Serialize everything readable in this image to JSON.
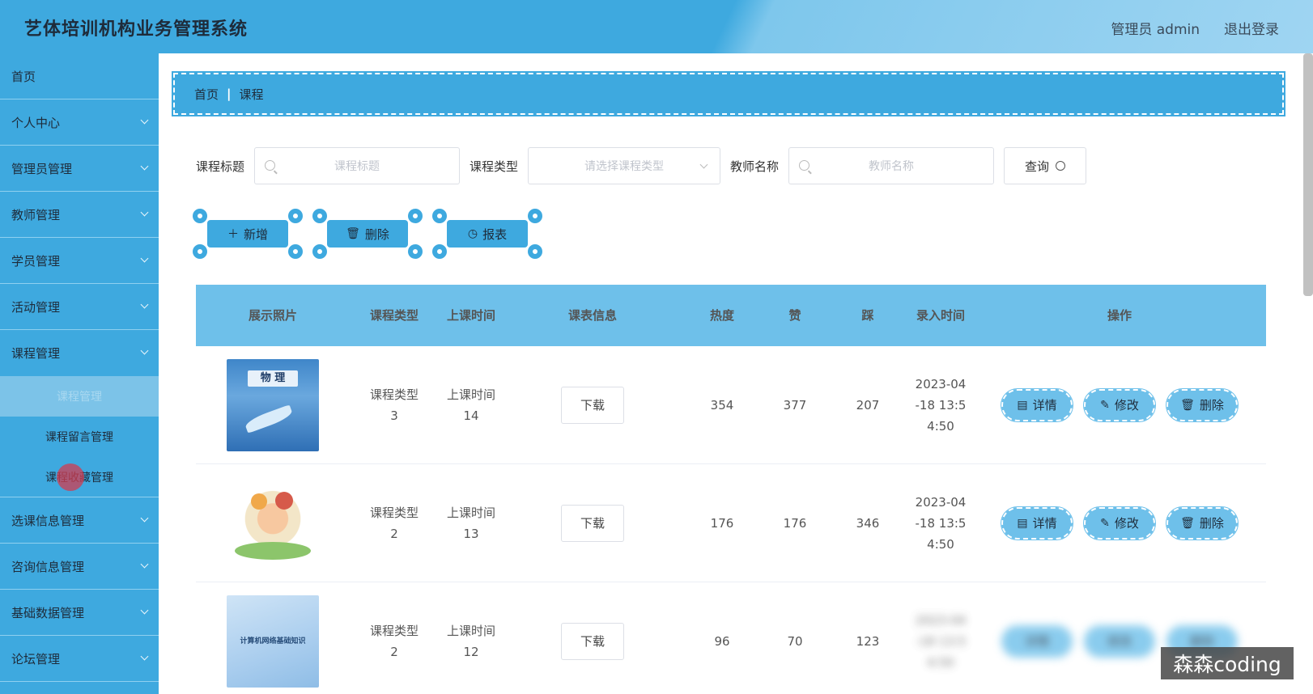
{
  "header": {
    "title": "艺体培训机构业务管理系统",
    "user": "管理员 admin",
    "logout": "退出登录"
  },
  "sidebar": {
    "items": [
      {
        "label": "首页"
      },
      {
        "label": "个人中心"
      },
      {
        "label": "管理员管理"
      },
      {
        "label": "教师管理"
      },
      {
        "label": "学员管理"
      },
      {
        "label": "活动管理"
      },
      {
        "label": "课程管理"
      }
    ],
    "submenu": [
      {
        "label": "课程管理"
      },
      {
        "label": "课程留言管理"
      },
      {
        "label": "课程收藏管理"
      }
    ],
    "items_after": [
      {
        "label": "选课信息管理"
      },
      {
        "label": "咨询信息管理"
      },
      {
        "label": "基础数据管理"
      },
      {
        "label": "论坛管理"
      }
    ]
  },
  "breadcrumb": {
    "home": "首页",
    "separator": "|",
    "current": "课程"
  },
  "search": {
    "title_label": "课程标题",
    "title_placeholder": "课程标题",
    "type_label": "课程类型",
    "type_placeholder": "请选择课程类型",
    "teacher_label": "教师名称",
    "teacher_placeholder": "教师名称",
    "query_label": "查询"
  },
  "actions": {
    "add": "新增",
    "delete": "删除",
    "report": "报表"
  },
  "table": {
    "headers": [
      "展示照片",
      "课程类型",
      "上课时间",
      "课表信息",
      "热度",
      "赞",
      "踩",
      "录入时间",
      "操作"
    ],
    "rows": [
      {
        "type_text": "课程类型",
        "type_val": "3",
        "time_text": "上课时间",
        "time_val": "14",
        "schedule": "下载",
        "heat": "354",
        "like": "377",
        "dislike": "207",
        "rec1": "2023-04",
        "rec2": "-18 13:5",
        "rec3": "4:50"
      },
      {
        "type_text": "课程类型",
        "type_val": "2",
        "time_text": "上课时间",
        "time_val": "13",
        "schedule": "下载",
        "heat": "176",
        "like": "176",
        "dislike": "346",
        "rec1": "2023-04",
        "rec2": "-18 13:5",
        "rec3": "4:50"
      },
      {
        "type_text": "课程类型",
        "type_val": "2",
        "time_text": "上课时间",
        "time_val": "12",
        "schedule": "下载",
        "heat": "96",
        "like": "70",
        "dislike": "123",
        "rec1": "2023-04",
        "rec2": "-18 13:5",
        "rec3": "4:50"
      }
    ],
    "ops": {
      "detail": "详情",
      "edit": "修改",
      "delete": "删除"
    },
    "thumb_text": {
      "physics": "物 理",
      "computer": "计算机网络基础知识"
    }
  },
  "watermark": "森森coding",
  "colors": {
    "primary": "#3ea9df",
    "header_row": "#6ec0ea",
    "accent": "#3ea9df"
  }
}
